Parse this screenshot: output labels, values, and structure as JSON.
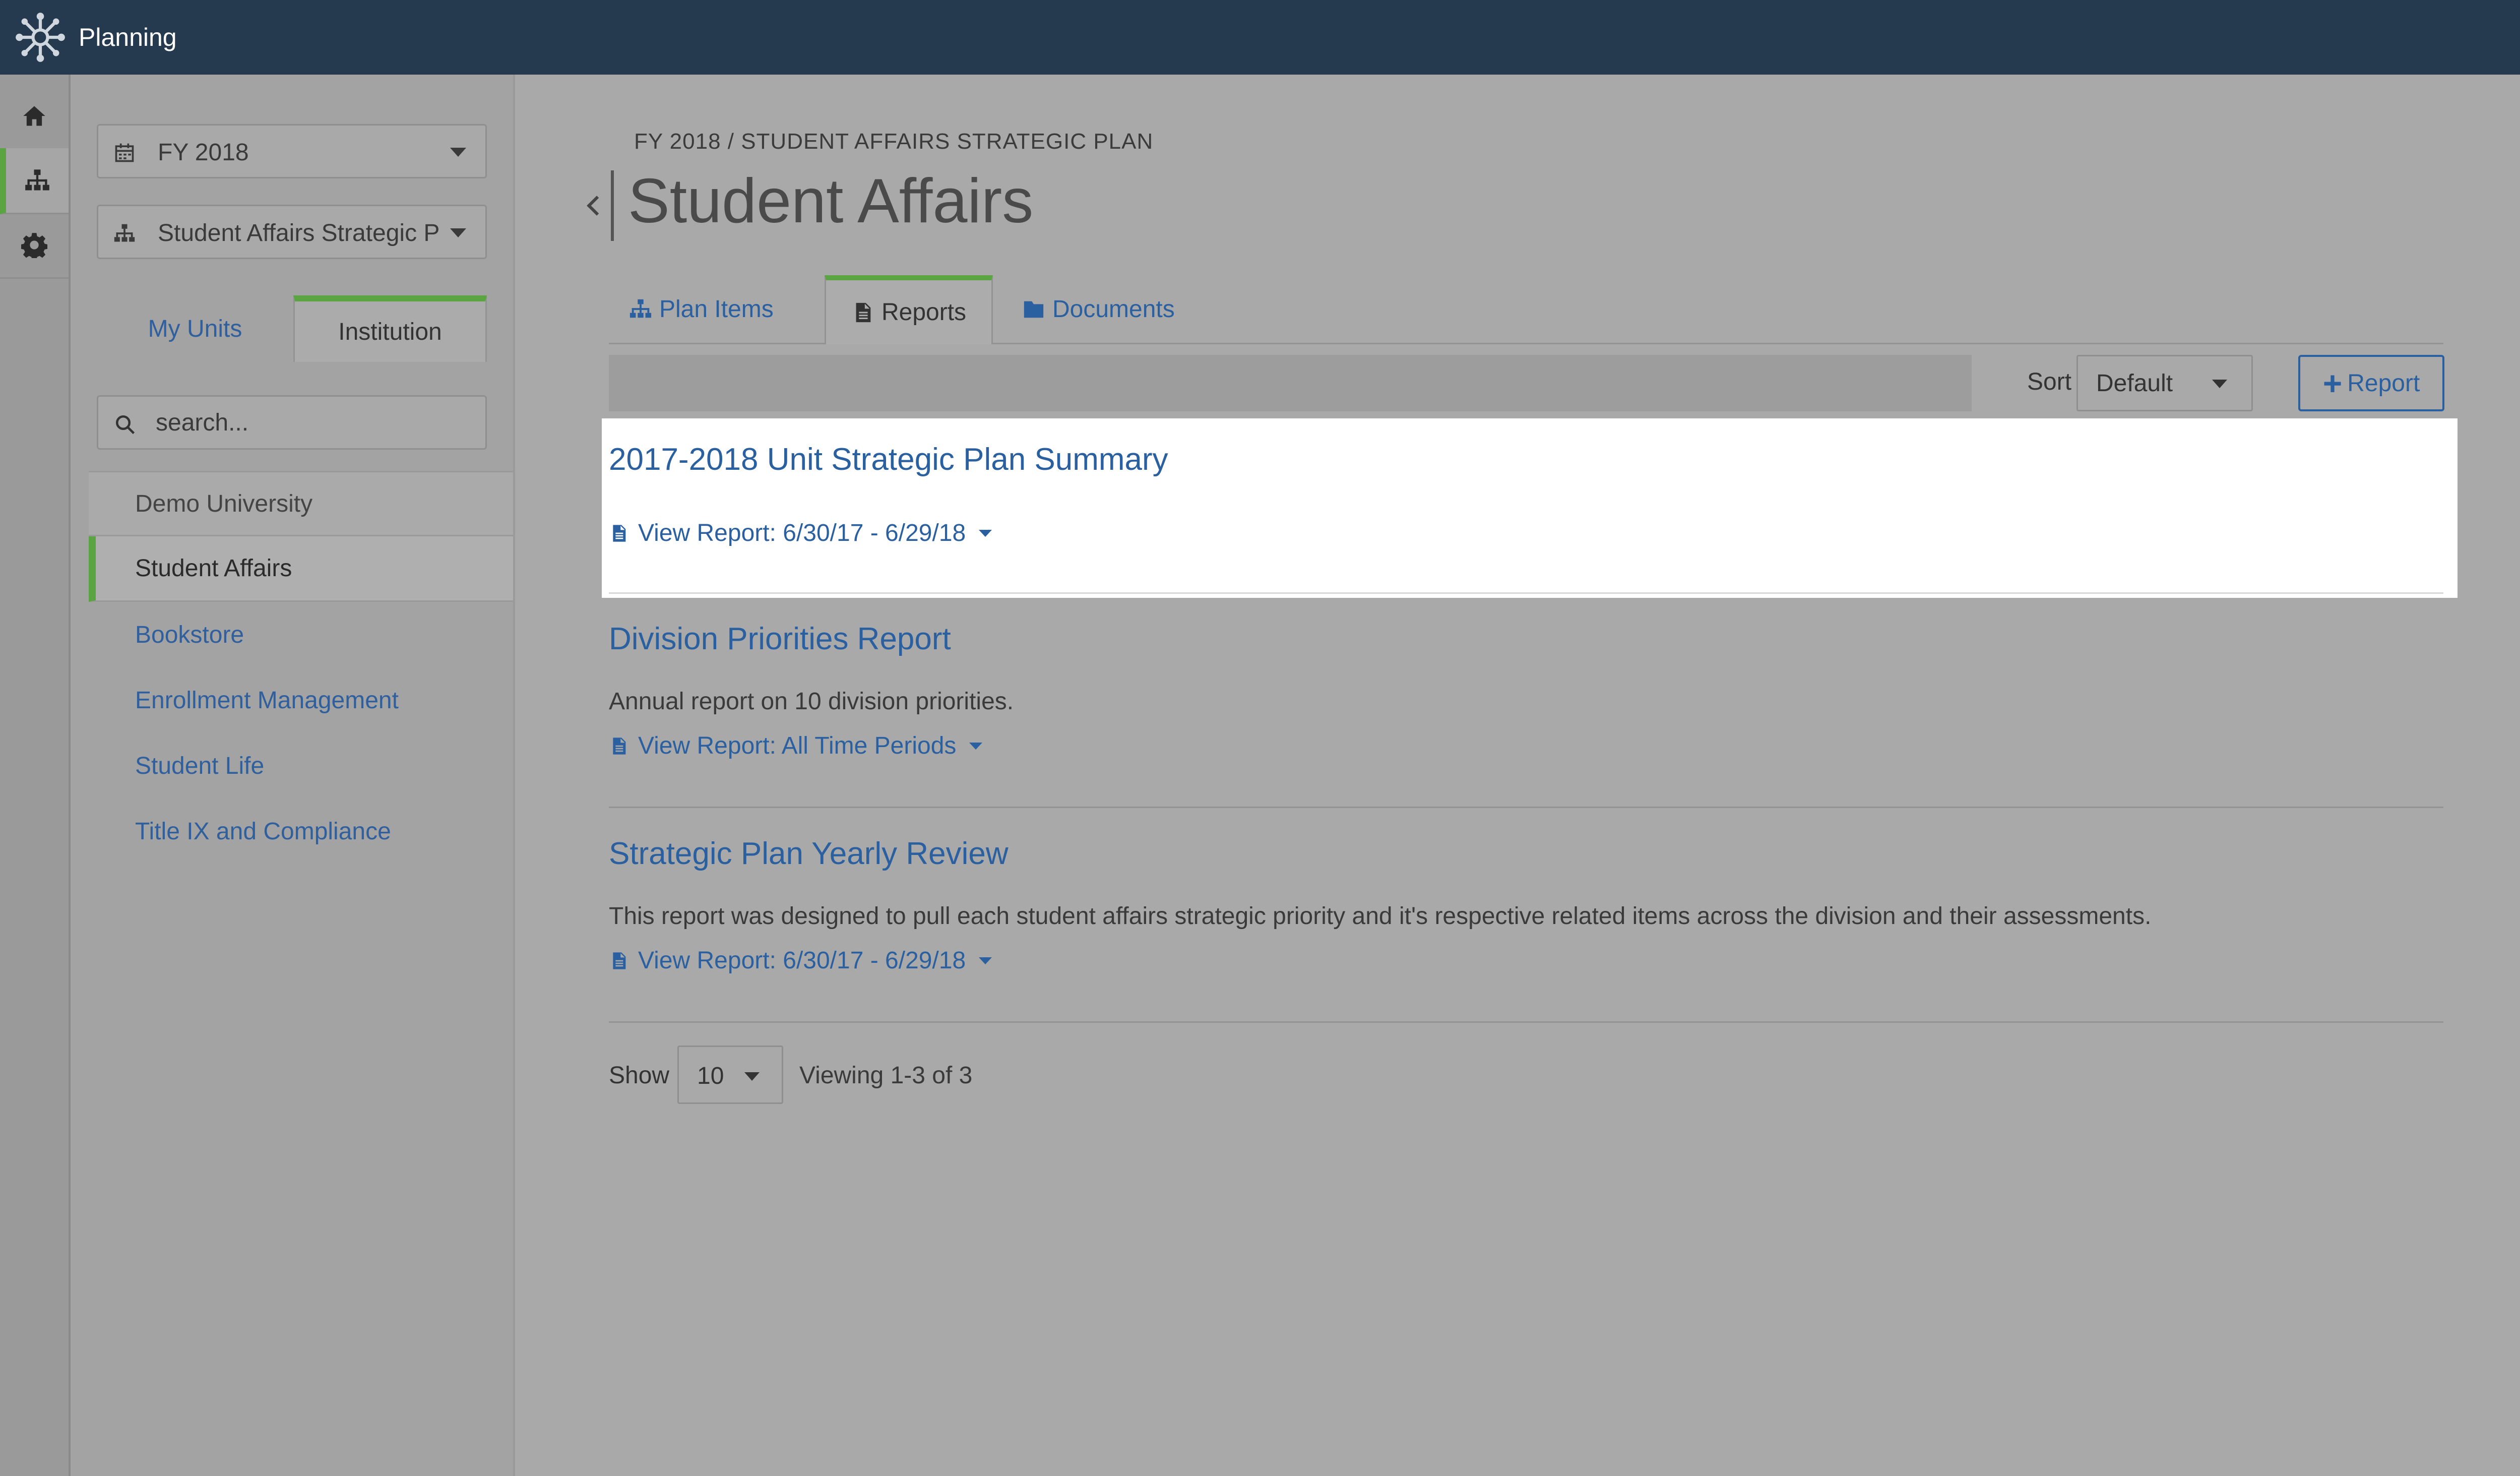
{
  "app": {
    "title": "Planning"
  },
  "rail": {
    "items": [
      "home-icon",
      "sitemap-icon",
      "gear-icon"
    ]
  },
  "sidebar": {
    "fiscal_year": "FY 2018",
    "plan_select": "Student Affairs Strategic P",
    "tabs": [
      "My Units",
      "Institution"
    ],
    "search_placeholder": "search...",
    "units": [
      {
        "label": "Demo University"
      },
      {
        "label": "Student Affairs"
      },
      {
        "label": "Bookstore"
      },
      {
        "label": "Enrollment Management"
      },
      {
        "label": "Student Life"
      },
      {
        "label": "Title IX and Compliance"
      }
    ]
  },
  "main": {
    "breadcrumb": "FY 2018 / STUDENT AFFAIRS STRATEGIC PLAN",
    "title": "Student Affairs",
    "tabs": [
      {
        "label": "Plan Items",
        "icon": "sitemap-icon"
      },
      {
        "label": "Reports",
        "icon": "document-icon"
      },
      {
        "label": "Documents",
        "icon": "folder-icon"
      }
    ],
    "sort_label": "Sort",
    "sort_value": "Default",
    "add_report_label": "Report",
    "reports": [
      {
        "title": "2017-2018 Unit Strategic Plan Summary",
        "description": "",
        "link": "View Report: 6/30/17 - 6/29/18"
      },
      {
        "title": "Division Priorities Report",
        "description": "Annual report on 10 division priorities.",
        "link": "View Report: All Time Periods"
      },
      {
        "title": "Strategic Plan Yearly Review",
        "description": "This report was designed to pull each student affairs strategic priority and it's respective related items across the division and their assessments.",
        "link": "View Report: 6/30/17 - 6/29/18"
      }
    ],
    "pager": {
      "show_label": "Show",
      "page_size": "10",
      "viewing": "Viewing 1-3 of 3"
    }
  },
  "colors": {
    "topbar": "#253a4e",
    "accent": "#5aa441",
    "link": "#2a5fa0"
  }
}
